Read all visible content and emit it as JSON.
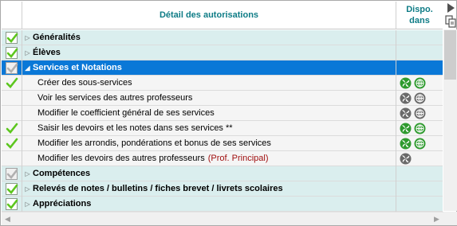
{
  "header": {
    "title": "Détail des autorisations",
    "dispo_line1": "Dispo.",
    "dispo_line2": "dans"
  },
  "colors": {
    "accent": "#0e7c86",
    "selection": "#0a78d7",
    "category_bg": "#daeeee",
    "check_green": "#5cc61e",
    "note_red": "#a01010"
  },
  "rows": [
    {
      "type": "cat",
      "label": "Généralités",
      "check": "green-box"
    },
    {
      "type": "cat",
      "label": "Élèves",
      "check": "green-box"
    },
    {
      "type": "cat",
      "label": "Services et Notations",
      "check": "grey-box",
      "selected": true
    },
    {
      "type": "sub",
      "label": "Créer des sous-services",
      "check": "tick",
      "icons": [
        "espace-green",
        "web-green"
      ]
    },
    {
      "type": "sub",
      "label": "Voir les services des autres professeurs",
      "check": "none",
      "icons": [
        "espace-grey",
        "web-grey"
      ]
    },
    {
      "type": "sub",
      "label": "Modifier le coefficient général de ses services",
      "check": "none",
      "icons": [
        "espace-grey",
        "web-grey"
      ]
    },
    {
      "type": "sub",
      "label": "Saisir les devoirs et les notes dans ses services **",
      "check": "tick",
      "icons": [
        "espace-green",
        "web-green"
      ]
    },
    {
      "type": "sub",
      "label": "Modifier les arrondis, pondérations et bonus de ses services",
      "check": "tick",
      "icons": [
        "espace-green",
        "web-green"
      ]
    },
    {
      "type": "sub",
      "label": "Modifier les devoirs des autres professeurs",
      "note": "(Prof. Principal)",
      "check": "none",
      "icons": [
        "espace-grey"
      ]
    },
    {
      "type": "cat",
      "label": "Compétences",
      "check": "grey-box"
    },
    {
      "type": "cat",
      "label": "Relevés de notes / bulletins / fiches brevet / livrets scolaires",
      "check": "green-box"
    },
    {
      "type": "cat",
      "label": "Appréciations",
      "check": "green-box"
    }
  ]
}
